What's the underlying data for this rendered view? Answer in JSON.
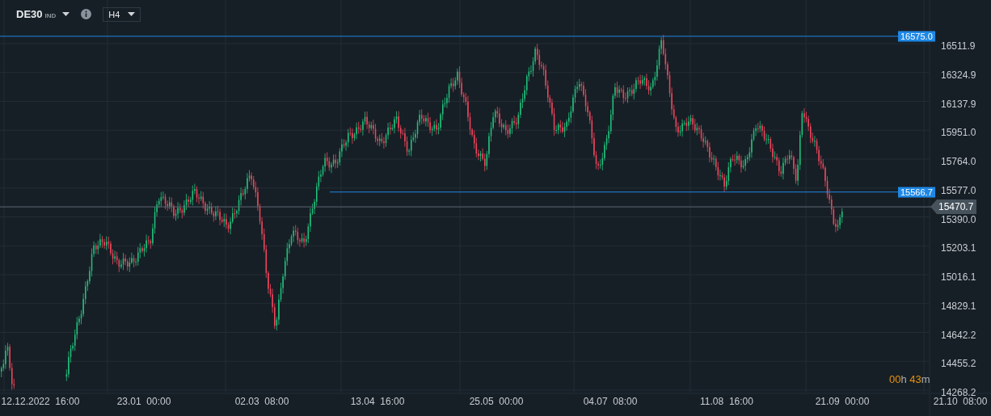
{
  "toolbar": {
    "symbol": "DE30",
    "market": "IND",
    "timeframe": "H4"
  },
  "price_axis": {
    "ticks": [
      "16511.9",
      "16324.9",
      "16137.9",
      "15951.0",
      "15764.0",
      "15577.0",
      "15390.0",
      "15203.1",
      "15016.1",
      "14829.1",
      "14642.2",
      "14455.2",
      "14268.2"
    ]
  },
  "price_lines": [
    {
      "kind": "level",
      "price": "16575.0"
    },
    {
      "kind": "level",
      "price": "15566.7"
    },
    {
      "kind": "current",
      "price": "15470.7"
    }
  ],
  "countdown": {
    "hours": "00",
    "hours_unit": "h",
    "minutes": "43",
    "minutes_unit": "m"
  },
  "time_axis": {
    "labels": [
      "12.12.2022  16:00",
      "23.01  00:00",
      "02.03  08:00",
      "13.04  16:00",
      "25.05  00:00",
      "04.07  08:00",
      "11.08  16:00",
      "21.09  00:00",
      "21.10  08:00"
    ]
  }
}
